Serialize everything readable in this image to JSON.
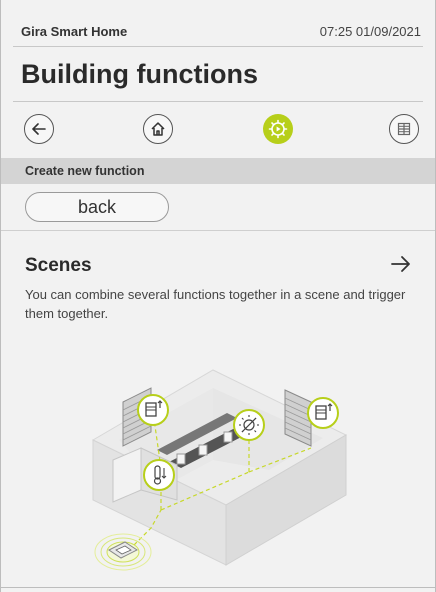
{
  "status_bar": {
    "app_name": "Gira Smart Home",
    "clock": "07:25 01/09/2021"
  },
  "page": {
    "title": "Building functions"
  },
  "nav": {
    "items": [
      {
        "name": "back-nav",
        "icon": "arrow-left-icon"
      },
      {
        "name": "home-nav",
        "icon": "house-icon"
      },
      {
        "name": "functions-nav",
        "icon": "gear-play-icon",
        "active": true
      },
      {
        "name": "rooms-nav",
        "icon": "grid-icon"
      }
    ],
    "accent": "#b7cf1a"
  },
  "section": {
    "label": "Create new function"
  },
  "back_button": {
    "label": "back"
  },
  "scenes": {
    "title": "Scenes",
    "description": "You can combine several functions together in a scene and trigger them together.",
    "arrow_icon": "arrow-right-icon"
  },
  "illustration": {
    "icons": [
      "blind-icon",
      "light-icon",
      "thermostat-icon",
      "blind-icon",
      "switch-panel-icon"
    ]
  }
}
